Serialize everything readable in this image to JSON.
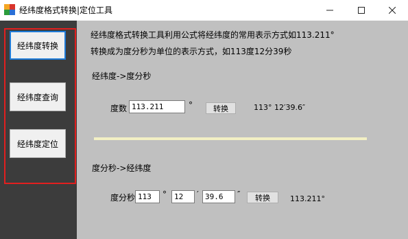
{
  "window": {
    "title": "经纬度格式转换|定位工具",
    "minimize": "—",
    "maximize": "☐",
    "close": "✕",
    "icon": "app-icon"
  },
  "sidebar": {
    "buttons": [
      {
        "label": "经纬度转换",
        "active": true
      },
      {
        "label": "经纬度查询",
        "active": false
      },
      {
        "label": "经纬度定位",
        "active": false
      }
    ],
    "highlight_color": "#e21f1f"
  },
  "main": {
    "intro_line1": "经纬度格式转换工具利用公式将经纬度的常用表示方式如113.211°",
    "intro_line2": "转换成为度分秒为单位的表示方式，如113度12分39秒",
    "section1": {
      "title": "经纬度->度分秒",
      "label": "度数",
      "value": "113.211",
      "unit": "°",
      "button": "转换",
      "result": "113° 12′39.6″"
    },
    "section2": {
      "title": "度分秒->经纬度",
      "label": "度分秒",
      "deg_value": "113",
      "deg_unit": "°",
      "min_value": "12",
      "min_unit": "′",
      "sec_value": "39.6",
      "sec_unit": "″",
      "button": "转换",
      "result": "113.211°"
    }
  }
}
